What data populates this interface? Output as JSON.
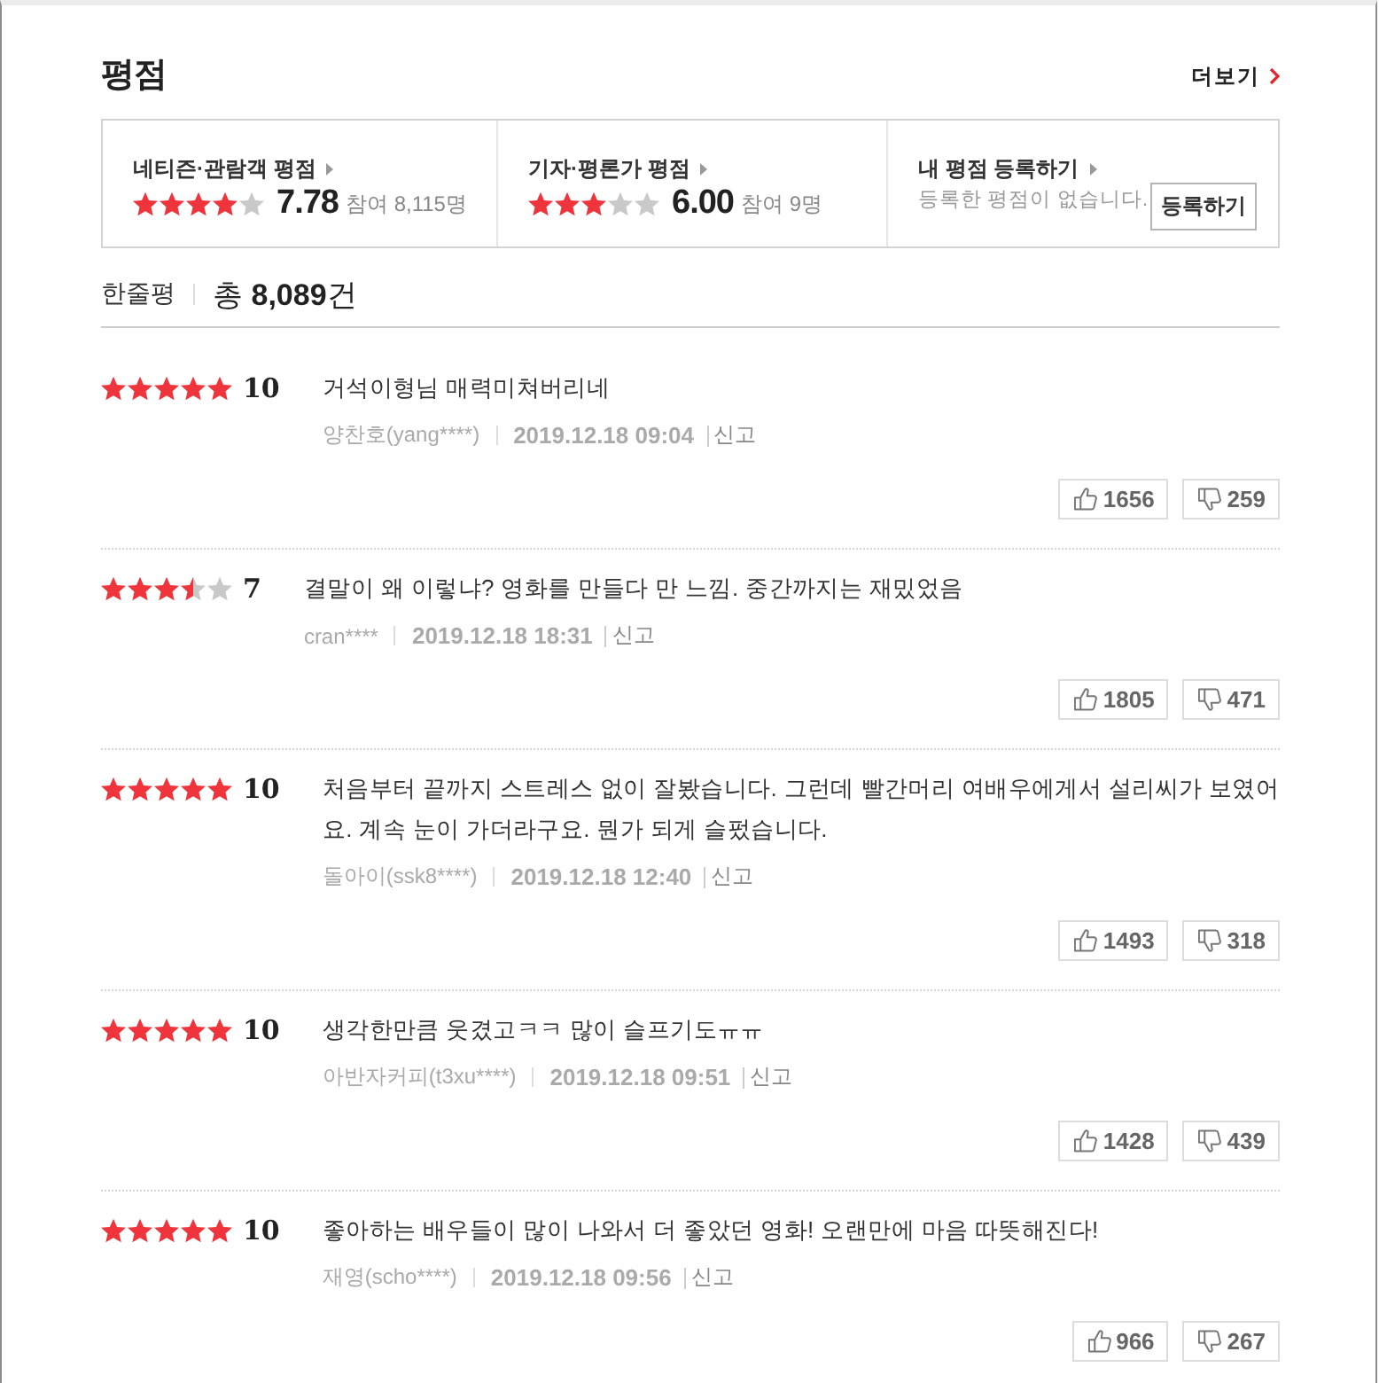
{
  "header": {
    "title": "평점",
    "more_link": "더보기"
  },
  "rating_summary": [
    {
      "kind": "score",
      "label": "네티즌·관람객 평점",
      "stars": 4,
      "score": "7.78",
      "participants": "참여 8,115명"
    },
    {
      "kind": "score",
      "label": "기자·평론가 평점",
      "stars": 3,
      "score": "6.00",
      "participants": "참여 9명"
    },
    {
      "kind": "register",
      "label": "내 평점 등록하기",
      "message": "등록한 평점이 없습니다.",
      "button": "등록하기"
    }
  ],
  "reviews_header": {
    "title": "한줄평",
    "total": "총 **8,089**건"
  },
  "reviews": [
    {
      "stars": 5,
      "score": "10",
      "text": "거석이형님 매력미쳐버리네",
      "author": "양찬호(yang****)",
      "date": "2019.12.18 09:04",
      "report": "신고",
      "likes": "1656",
      "dislikes": "259"
    },
    {
      "stars": 3.5,
      "score": "7",
      "text": "결말이 왜 이렇냐? 영화를 만들다 만 느낌. 중간까지는 재밌었음",
      "author": "cran****",
      "date": "2019.12.18 18:31",
      "report": "신고",
      "likes": "1805",
      "dislikes": "471"
    },
    {
      "stars": 5,
      "score": "10",
      "text": "처음부터 끝까지 스트레스 없이 잘봤습니다. 그런데 빨간머리 여배우에게서 설리씨가 보였어요. 계속 눈이 가더라구요. 뭔가 되게 슬펐습니다.",
      "author": "돌아이(ssk8****)",
      "date": "2019.12.18 12:40",
      "report": "신고",
      "likes": "1493",
      "dislikes": "318"
    },
    {
      "stars": 5,
      "score": "10",
      "text": "생각한만큼 웃겼고ㅋㅋ 많이 슬프기도ㅠㅠ",
      "author": "아반자커피(t3xu****)",
      "date": "2019.12.18 09:51",
      "report": "신고",
      "likes": "1428",
      "dislikes": "439"
    },
    {
      "stars": 5,
      "score": "10",
      "text": "좋아하는 배우들이 많이 나와서 더 좋았던 영화! 오랜만에 마음 따뜻해진다!",
      "author": "재영(scho****)",
      "date": "2019.12.18 09:56",
      "report": "신고",
      "likes": "966",
      "dislikes": "267"
    }
  ]
}
